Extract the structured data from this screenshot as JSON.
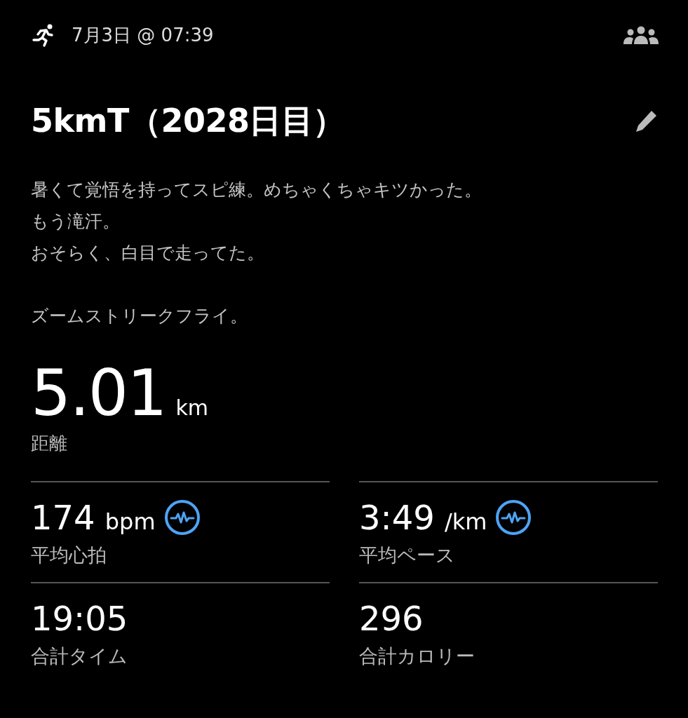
{
  "header": {
    "date": "7月3日 @ 07:39"
  },
  "title": "5kmT（2028日目）",
  "description": [
    {
      "lines": [
        "暑くて覚悟を持ってスピ練。めちゃくちゃキツかった。",
        "もう滝汗。",
        "おそらく、白目で走ってた。"
      ]
    },
    {
      "lines": [
        "ズームストリークフライ。"
      ]
    }
  ],
  "distance": {
    "value": "5.01",
    "unit": "km",
    "label": "距離"
  },
  "stats": [
    {
      "value": "174",
      "unit": "bpm",
      "label": "平均心拍",
      "kind": "chart"
    },
    {
      "value": "3:49",
      "unit": "/km",
      "label": "平均ペース",
      "kind": "chart"
    },
    {
      "value": "19:05",
      "label": "合計タイム",
      "kind": "plain"
    },
    {
      "value": "296",
      "label": "合計カロリー",
      "kind": "plain"
    }
  ]
}
